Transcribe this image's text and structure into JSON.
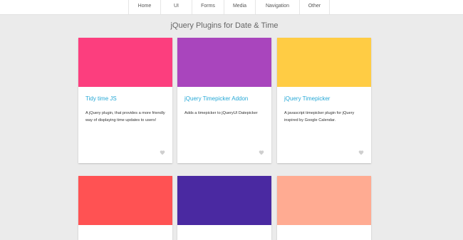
{
  "nav": {
    "items": [
      "Home",
      "UI",
      "Forms",
      "Media",
      "Navigation",
      "Other"
    ]
  },
  "page": {
    "title": "jQuery Plugins for Date & Time"
  },
  "cards": [
    {
      "color": "#fc3e7e",
      "title": "Tidy time JS",
      "description": "A jQuery plugin, that provides a more friendly way of displaying time updates to users!",
      "icon": "heart-icon"
    },
    {
      "color": "#a945bd",
      "title": "jQuery Timepicker Addon",
      "description": "Adds a timepicker to jQueryUI Datepicker",
      "icon": "heart-icon"
    },
    {
      "color": "#ffcc44",
      "title": "jQuery Timepicker",
      "description": "A javascript timepicker plugin for jQuery inspired by Google Calendar.",
      "icon": "heart-icon"
    },
    {
      "color": "#ff5253"
    },
    {
      "color": "#4a29a1"
    },
    {
      "color": "#ffab92"
    }
  ]
}
